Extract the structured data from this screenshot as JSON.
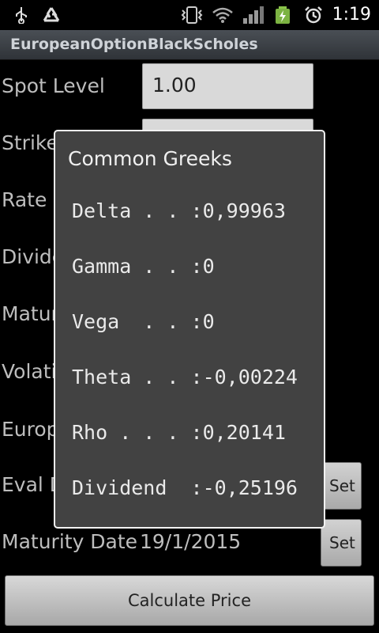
{
  "status_bar": {
    "time": "1:19",
    "icons": [
      "usb-icon",
      "recycle-icon",
      "vibrate-icon",
      "wifi-icon",
      "signal-icon",
      "battery-charging-icon",
      "alarm-icon"
    ]
  },
  "app": {
    "title": "EuropeanOptionBlackScholes"
  },
  "form": {
    "spot_label": "Spot Level",
    "spot_value": "1.00",
    "strike_label": "Strike",
    "rate_label": "Rate",
    "dividend_label": "Divide",
    "maturity_label": "Matur",
    "volatility_label": "Volati",
    "european_label": "Europ",
    "eval_date_label": "Eval D",
    "eval_set_label": "Set",
    "maturity_date_label": "Maturity Date",
    "maturity_date_value": "19/1/2015",
    "maturity_set_label": "Set",
    "calculate_label": "Calculate Price"
  },
  "dialog": {
    "title": "Common Greeks",
    "lines": [
      "Delta . . :0,99963",
      "Gamma . . :0",
      "Vega  . . :0",
      "Theta . . :-0,00224",
      "Rho . . . :0,20141",
      "Dividend  :-0,25196"
    ]
  },
  "colors": {
    "background": "#000000",
    "dialog_bg": "#424242",
    "label_text": "#bdbdbd",
    "title_text": "#cfd3d8"
  }
}
